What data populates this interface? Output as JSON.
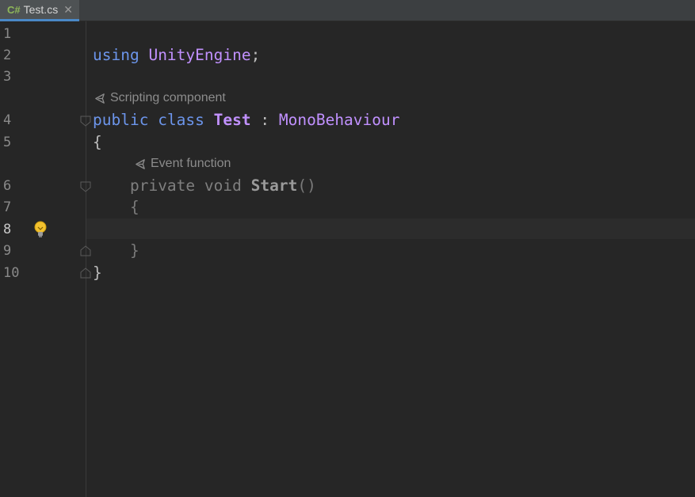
{
  "tab": {
    "lang_label": "C#",
    "file_name": "Test.cs",
    "close_glyph": "✕"
  },
  "gutter": {
    "line_numbers": [
      "1",
      "2",
      "3",
      "4",
      "5",
      "6",
      "7",
      "8",
      "9",
      "10"
    ],
    "current_line": 8
  },
  "hints": {
    "scripting_component": "Scripting component",
    "event_function": "Event function"
  },
  "code": {
    "line2": {
      "kw": "using",
      "ns": "UnityEngine",
      "semi": ";"
    },
    "line4": {
      "kw1": "public",
      "kw2": "class",
      "name": "Test",
      "colon": ":",
      "base": "MonoBehaviour"
    },
    "line5": {
      "brace": "{"
    },
    "line6": {
      "kw1": "private",
      "kw2": "void",
      "fn": "Start",
      "parens": "()"
    },
    "line7": {
      "brace": "{"
    },
    "line9": {
      "brace": "}"
    },
    "line10": {
      "brace": "}"
    }
  },
  "icons": {
    "unity": "unity-icon",
    "bulb": "lightbulb-icon",
    "fold": "fold-marker-icon"
  },
  "colors": {
    "background": "#262626",
    "keyword": "#6c95eb",
    "type": "#c191ff",
    "bulb": "#f2c12e",
    "tab_accent": "#4a88c7"
  }
}
